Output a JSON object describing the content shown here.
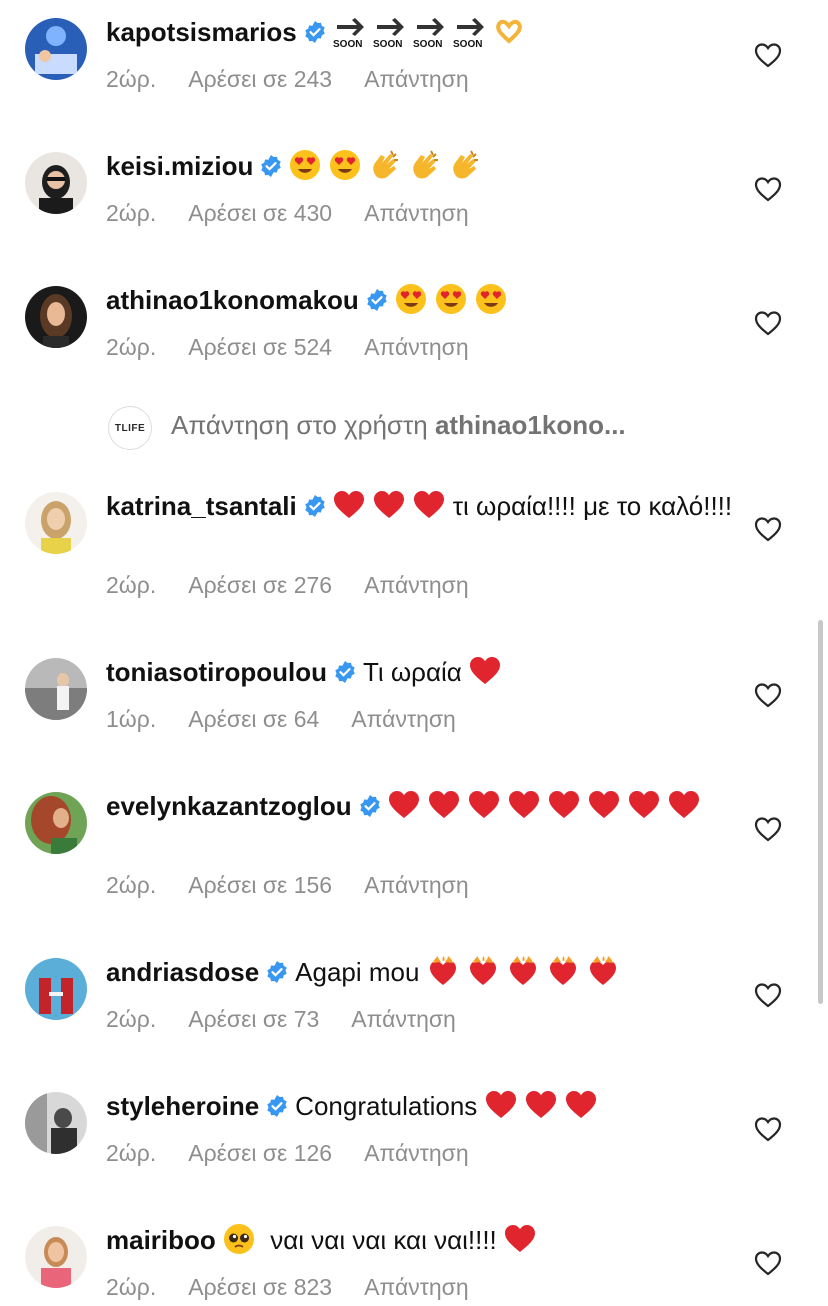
{
  "comments": [
    {
      "user": "kapotsismarios",
      "text": "",
      "time": "2ώρ.",
      "likes": "Αρέσει σε 243",
      "reply": "Απάντηση",
      "emoji": [
        "soon-arrow-icon",
        "soon-arrow-icon",
        "soon-arrow-icon",
        "soon-arrow-icon",
        "heart-hands-icon"
      ],
      "soon_label": "SOON"
    },
    {
      "user": "keisi.miziou",
      "text": "",
      "time": "2ώρ.",
      "likes": "Αρέσει σε 430",
      "reply": "Απάντηση",
      "emoji": [
        "heart-eyes-icon",
        "heart-eyes-icon",
        "clapping-icon",
        "clapping-icon",
        "clapping-icon"
      ]
    },
    {
      "user": "athinao1konomakou",
      "text": "",
      "time": "2ώρ.",
      "likes": "Αρέσει σε 524",
      "reply": "Απάντηση",
      "emoji": [
        "heart-eyes-icon",
        "heart-eyes-icon",
        "heart-eyes-icon"
      ]
    },
    {
      "user": "katrina_tsantali",
      "text": "τι ωραία!!!! με το καλό!!!!",
      "time": "2ώρ.",
      "likes": "Αρέσει σε 276",
      "reply": "Απάντηση",
      "emoji": [
        "red-heart-icon",
        "red-heart-icon",
        "red-heart-icon"
      ]
    },
    {
      "user": "toniasotiropoulou",
      "text": "Τι ωραία",
      "time": "1ώρ.",
      "likes": "Αρέσει σε 64",
      "reply": "Απάντηση",
      "emoji": [
        "red-heart-icon"
      ]
    },
    {
      "user": "evelynkazantzoglou",
      "text": "",
      "time": "2ώρ.",
      "likes": "Αρέσει σε 156",
      "reply": "Απάντηση",
      "emoji": [
        "red-heart-icon",
        "red-heart-icon",
        "red-heart-icon",
        "red-heart-icon",
        "red-heart-icon",
        "red-heart-icon",
        "red-heart-icon",
        "red-heart-icon"
      ]
    },
    {
      "user": "andriasdose",
      "text": "Agapi mou",
      "time": "2ώρ.",
      "likes": "Αρέσει σε 73",
      "reply": "Απάντηση",
      "emoji": [
        "heart-on-fire-icon",
        "heart-on-fire-icon",
        "heart-on-fire-icon",
        "heart-on-fire-icon",
        "heart-on-fire-icon"
      ]
    },
    {
      "user": "styleheroine",
      "text": "Congratulations",
      "time": "2ώρ.",
      "likes": "Αρέσει σε 126",
      "reply": "Απάντηση",
      "emoji": [
        "red-heart-icon",
        "red-heart-icon",
        "red-heart-icon"
      ]
    },
    {
      "user": "mairiboo",
      "text": "ναι ναι ναι και ναι!!!!",
      "time": "2ώρ.",
      "likes": "Αρέσει σε 823",
      "reply": "Απάντηση",
      "emoji": [
        "pleading-face-icon",
        "red-heart-icon"
      ]
    }
  ],
  "reply_thread": {
    "logo_text": "TLIFE",
    "prefix": "Απάντηση στο χρήστη",
    "target_user": "athinao1kono..."
  },
  "colors": {
    "verified": "#3897f0",
    "meta_gray": "#8e8e8e",
    "heart_red": "#e0252f"
  }
}
